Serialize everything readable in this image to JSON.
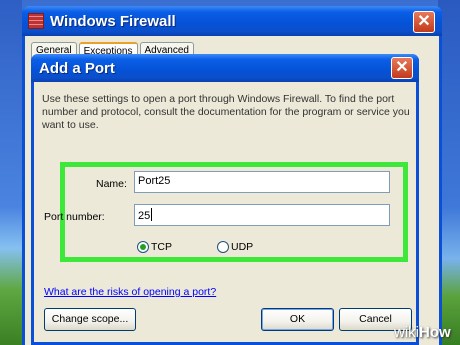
{
  "background_window": {
    "title": "Windows Firewall",
    "close_label": "✕",
    "tabs": [
      {
        "label": "General",
        "active": false
      },
      {
        "label": "Exceptions",
        "active": true
      },
      {
        "label": "Advanced",
        "active": false
      }
    ]
  },
  "dialog": {
    "title": "Add a Port",
    "close_label": "✕",
    "description": "Use these settings to open a port through Windows Firewall. To find the port number and protocol, consult the documentation for the program or service you want to use.",
    "name_label": "Name:",
    "name_value": "Port25",
    "port_label": "Port number:",
    "port_value": "25",
    "protocol": {
      "options": [
        {
          "label": "TCP",
          "checked": true
        },
        {
          "label": "UDP",
          "checked": false
        }
      ]
    },
    "risk_link": "What are the risks of opening a port?",
    "change_scope_button": "Change scope...",
    "ok_button": "OK",
    "cancel_button": "Cancel"
  },
  "watermark": {
    "wiki": "wiki",
    "how": "How"
  },
  "colors": {
    "titlebar_blue": "#0552d6",
    "highlight_green": "#3ee83a",
    "dialog_bg": "#ece9d8",
    "link_blue": "#0000ff"
  }
}
